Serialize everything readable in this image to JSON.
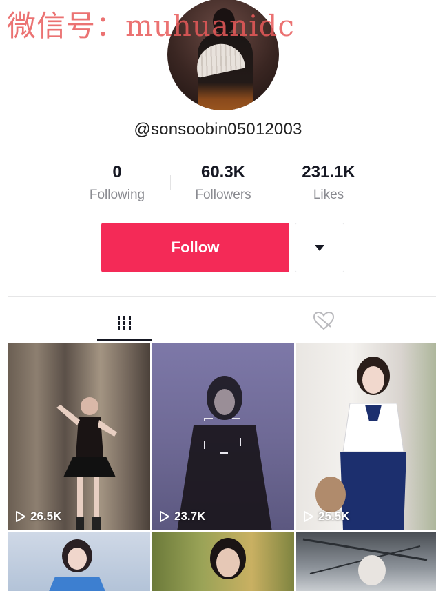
{
  "watermark": "微信号：muhuanidc",
  "profile": {
    "username": "@sonsoobin05012003"
  },
  "stats": [
    {
      "value": "0",
      "label": "Following"
    },
    {
      "value": "60.3K",
      "label": "Followers"
    },
    {
      "value": "231.1K",
      "label": "Likes"
    }
  ],
  "actions": {
    "follow_label": "Follow",
    "more_icon": "caret-down-icon"
  },
  "tabs": [
    {
      "icon": "videos-grid-icon",
      "active": true
    },
    {
      "icon": "liked-heart-icon",
      "active": false
    }
  ],
  "videos": [
    {
      "views": "26.5K"
    },
    {
      "views": "23.7K"
    },
    {
      "views": "25.5K"
    },
    {
      "views": ""
    },
    {
      "views": ""
    },
    {
      "views": ""
    }
  ],
  "colors": {
    "accent": "#f42a57",
    "watermark": "#e85a5a",
    "muted_text": "#8a8b91"
  }
}
